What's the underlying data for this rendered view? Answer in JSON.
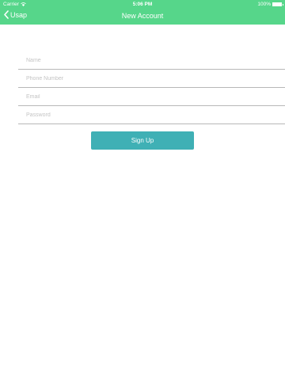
{
  "status_bar": {
    "carrier": "Carrier",
    "time": "5:06 PM",
    "battery": "100%"
  },
  "nav": {
    "back_label": "Usap",
    "title": "New Account"
  },
  "form": {
    "fields": [
      {
        "placeholder": "Name",
        "value": ""
      },
      {
        "placeholder": "Phone Number",
        "value": ""
      },
      {
        "placeholder": "Email",
        "value": ""
      },
      {
        "placeholder": "Password",
        "value": ""
      }
    ],
    "submit_label": "Sign Up"
  },
  "colors": {
    "header": "#56d68a",
    "button": "#3fb0b5",
    "divider": "#b8b8b8"
  },
  "icons": {
    "wifi": "wifi-icon",
    "battery": "battery-icon",
    "back": "chevron-left-icon"
  }
}
